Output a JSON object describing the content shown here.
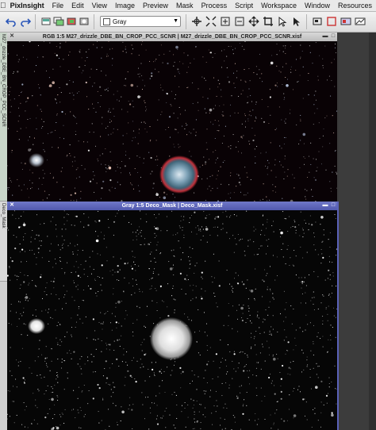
{
  "menubar": {
    "app": "PixInsight",
    "items": [
      "File",
      "Edit",
      "View",
      "Image",
      "Preview",
      "Mask",
      "Process",
      "Script",
      "Workspace",
      "Window",
      "Resources"
    ]
  },
  "toolbar": {
    "mask_mode_select": "Gray"
  },
  "side_tabs": [
    {
      "label": "M27_drizzle_DBE_BN_CROP_PCC_SCNR"
    },
    {
      "label": "Deco_Mask"
    }
  ],
  "windows": [
    {
      "title": "RGB 1:5 M27_drizzle_DBE_BN_CROP_PCC_SCNR | M27_drizzle_DBE_BN_CROP_PCC_SCNR.xisf"
    },
    {
      "title": "Gray 1:5 Deco_Mask | Deco_Mask.xisf"
    }
  ],
  "colors": {
    "active_titlebar": "#5a62b8",
    "nebula_core": "#7fa3b8",
    "nebula_rim": "#c0303a"
  }
}
